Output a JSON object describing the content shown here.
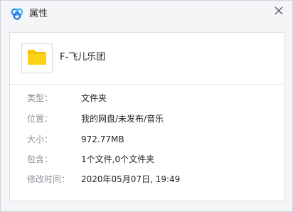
{
  "window": {
    "title": "属性",
    "app_icon": "baidu-netdisk-cloud-icon",
    "close_icon": "close-icon"
  },
  "file": {
    "name": "F-飞儿乐团",
    "icon": "folder-icon",
    "icon_color": "#f5c400"
  },
  "properties": [
    {
      "label": "类型：",
      "value": "文件夹"
    },
    {
      "label": "位置：",
      "value": "我的网盘/未发布/音乐"
    },
    {
      "label": "大小：",
      "value": "972.77MB"
    },
    {
      "label": "包含：",
      "value": "1个文件,0个文件夹"
    },
    {
      "label": "修改时间：",
      "value": "2020年05月07日, 19:49"
    }
  ]
}
